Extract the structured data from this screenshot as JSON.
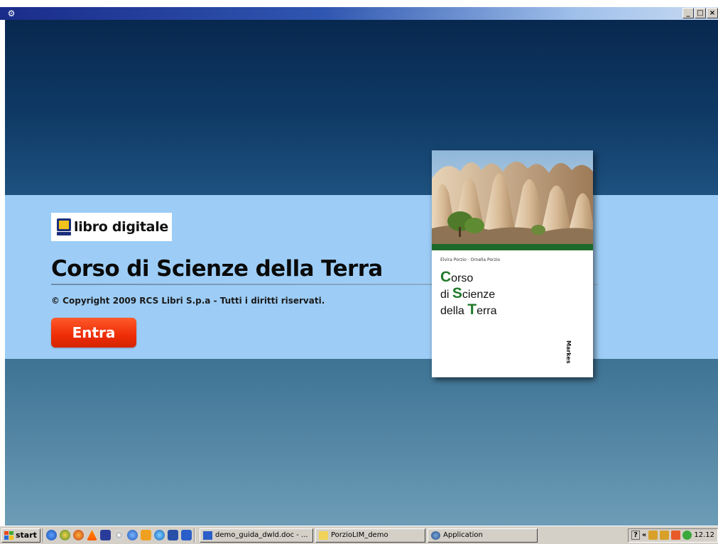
{
  "window": {
    "icon": "gear-icon",
    "controls": [
      "_",
      "□",
      "×"
    ]
  },
  "logo": {
    "text": "libro digitale",
    "icon": "monitor-icon",
    "colors": {
      "screen": "#f4c21a",
      "frame": "#1a2f7a"
    }
  },
  "main": {
    "title": "Corso di Scienze della Terra",
    "copyright": "© Copyright 2009 RCS Libri S.p.a - Tutti i diritti riservati.",
    "enter_button": "Entra"
  },
  "book": {
    "authors": "Elvira Porzio · Ornella Porzio",
    "strip_left": "",
    "strip_right": "",
    "title_lines": [
      {
        "cap": "C",
        "rest": "orso"
      },
      {
        "pre": "di ",
        "cap": "S",
        "rest": "cienze"
      },
      {
        "pre": "della ",
        "cap": "T",
        "rest": "erra"
      }
    ],
    "publisher": "Markes",
    "accent_color": "#1f7a2a"
  },
  "taskbar": {
    "start_label": "start",
    "quick_launch": [
      "ie-icon",
      "chrome-like-icon",
      "firefox-icon",
      "vlc-icon",
      "app-icon",
      "cd-icon",
      "media-icon",
      "folder-icon",
      "ie-icon",
      "book-icon",
      "word-icon"
    ],
    "tasks": [
      {
        "icon": "word-doc-icon",
        "label": "demo_guida_dwld.doc - ..."
      },
      {
        "icon": "folder-icon",
        "label": "PorzioLIM_demo"
      },
      {
        "icon": "application-icon",
        "label": "Application"
      }
    ],
    "tray_help": "?",
    "tray_chevron": "«",
    "clock": "12.12"
  },
  "colors": {
    "bg_top": "#0f3a66",
    "band": "#9dcdf6",
    "bg_bottom": "#5789a6",
    "button": "#ee2d08"
  }
}
